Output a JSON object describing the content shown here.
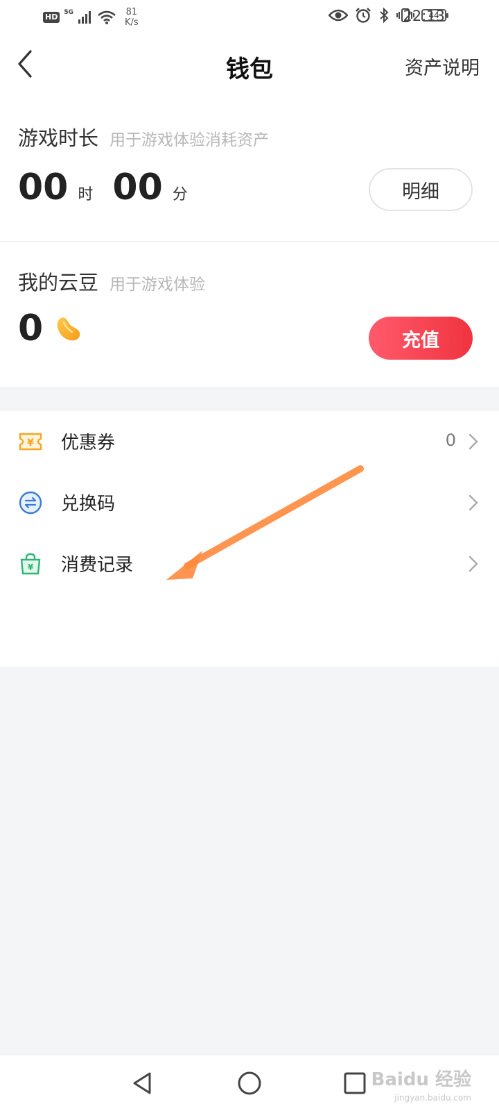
{
  "status_bar": {
    "hd": "HD",
    "network": "5G",
    "speed_value": "81",
    "speed_unit": "K/s",
    "battery": "44",
    "time": "22:13"
  },
  "nav": {
    "title": "钱包",
    "right_link": "资产说明"
  },
  "game_time": {
    "title": "游戏时长",
    "subtitle": "用于游戏体验消耗资产",
    "hours": "00",
    "hours_unit": "时",
    "minutes": "00",
    "minutes_unit": "分",
    "detail_button": "明细"
  },
  "cloud_beans": {
    "title": "我的云豆",
    "subtitle": "用于游戏体验",
    "amount": "0",
    "recharge_button": "充值"
  },
  "menu": {
    "items": [
      {
        "label": "优惠券",
        "count": "0",
        "icon": "coupon-icon"
      },
      {
        "label": "兑换码",
        "icon": "exchange-icon"
      },
      {
        "label": "消费记录",
        "icon": "shopping-bag-icon"
      }
    ]
  },
  "colors": {
    "accent": "#f0333f",
    "coupon": "#f5a623",
    "exchange": "#3a7bd5",
    "record": "#2bb673",
    "arrow": "#ff8a3d"
  },
  "watermark": {
    "brand": "Baidu 经验",
    "url": "jingyan.baidu.com"
  }
}
